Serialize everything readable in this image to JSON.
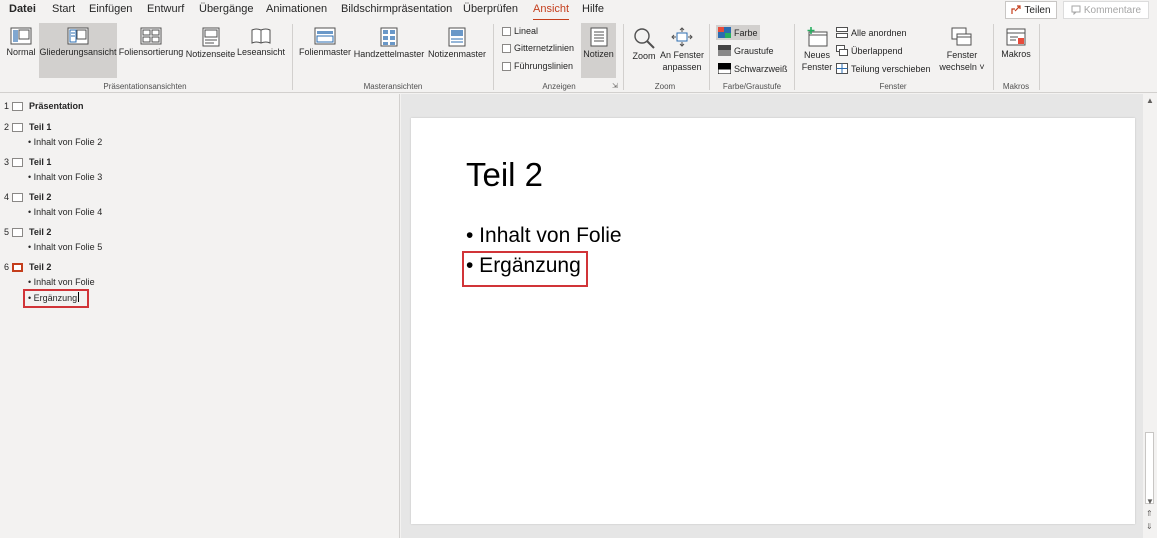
{
  "menu": {
    "tabs": [
      "Datei",
      "Start",
      "Einfügen",
      "Entwurf",
      "Übergänge",
      "Animationen",
      "Bildschirmpräsentation",
      "Überprüfen",
      "Ansicht",
      "Hilfe"
    ],
    "share_label": "Teilen",
    "comment_label": "Kommentare"
  },
  "ribbon": {
    "praesentationsansichten": {
      "label": "Präsentationsansichten",
      "buttons": [
        "Normal",
        "Gliederungsansicht",
        "Foliensortierung",
        "Notizenseite",
        "Leseansicht"
      ]
    },
    "masteransichten": {
      "label": "Masteransichten",
      "buttons": [
        "Folienmaster",
        "Handzettelmaster",
        "Notizenmaster"
      ]
    },
    "anzeigen": {
      "label": "Anzeigen",
      "checkboxes": [
        "Lineal",
        "Gitternetzlinien",
        "Führungslinien"
      ],
      "notes_button": "Notizen"
    },
    "zoom": {
      "label": "Zoom",
      "zoom_button": "Zoom",
      "fit_line1": "An Fenster",
      "fit_line2": "anpassen"
    },
    "farbe": {
      "label": "Farbe/Graustufe",
      "buttons": [
        "Farbe",
        "Graustufe",
        "Schwarzweiß"
      ]
    },
    "fenster": {
      "label": "Fenster",
      "new_line1": "Neues",
      "new_line2": "Fenster",
      "small": [
        "Alle anordnen",
        "Überlappend",
        "Teilung verschieben"
      ],
      "switch_line1": "Fenster",
      "switch_line2": "wechseln ˅"
    },
    "makros": {
      "label": "Makros",
      "button": "Makros"
    }
  },
  "outline": {
    "slides": [
      {
        "num": "1",
        "title": "Präsentation",
        "bullets": []
      },
      {
        "num": "2",
        "title": "Teil 1",
        "bullets": [
          "• Inhalt von Folie 2"
        ]
      },
      {
        "num": "3",
        "title": "Teil 1",
        "bullets": [
          "• Inhalt von Folie 3"
        ]
      },
      {
        "num": "4",
        "title": "Teil 2",
        "bullets": [
          "• Inhalt von Folie 4"
        ]
      },
      {
        "num": "5",
        "title": "Teil 2",
        "bullets": [
          "• Inhalt von Folie 5"
        ]
      },
      {
        "num": "6",
        "title": "Teil 2",
        "bullets": [
          "• Inhalt von Folie",
          "• Ergänzung"
        ]
      }
    ]
  },
  "slide": {
    "title": "Teil 2",
    "bullets": [
      "• Inhalt von Folie",
      "• Ergänzung"
    ]
  },
  "colors": {
    "accent": "#c43e1c",
    "highlight": "#d13438"
  }
}
